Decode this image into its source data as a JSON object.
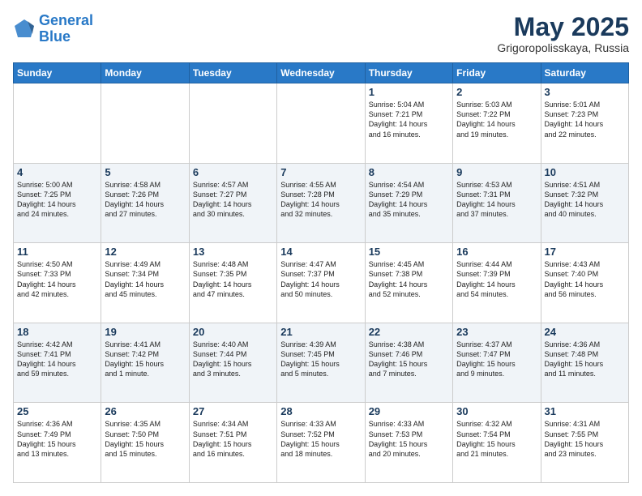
{
  "header": {
    "logo_line1": "General",
    "logo_line2": "Blue",
    "month": "May 2025",
    "location": "Grigoropolisskaya, Russia"
  },
  "weekdays": [
    "Sunday",
    "Monday",
    "Tuesday",
    "Wednesday",
    "Thursday",
    "Friday",
    "Saturday"
  ],
  "weeks": [
    [
      {
        "day": "",
        "text": ""
      },
      {
        "day": "",
        "text": ""
      },
      {
        "day": "",
        "text": ""
      },
      {
        "day": "",
        "text": ""
      },
      {
        "day": "1",
        "text": "Sunrise: 5:04 AM\nSunset: 7:21 PM\nDaylight: 14 hours\nand 16 minutes."
      },
      {
        "day": "2",
        "text": "Sunrise: 5:03 AM\nSunset: 7:22 PM\nDaylight: 14 hours\nand 19 minutes."
      },
      {
        "day": "3",
        "text": "Sunrise: 5:01 AM\nSunset: 7:23 PM\nDaylight: 14 hours\nand 22 minutes."
      }
    ],
    [
      {
        "day": "4",
        "text": "Sunrise: 5:00 AM\nSunset: 7:25 PM\nDaylight: 14 hours\nand 24 minutes."
      },
      {
        "day": "5",
        "text": "Sunrise: 4:58 AM\nSunset: 7:26 PM\nDaylight: 14 hours\nand 27 minutes."
      },
      {
        "day": "6",
        "text": "Sunrise: 4:57 AM\nSunset: 7:27 PM\nDaylight: 14 hours\nand 30 minutes."
      },
      {
        "day": "7",
        "text": "Sunrise: 4:55 AM\nSunset: 7:28 PM\nDaylight: 14 hours\nand 32 minutes."
      },
      {
        "day": "8",
        "text": "Sunrise: 4:54 AM\nSunset: 7:29 PM\nDaylight: 14 hours\nand 35 minutes."
      },
      {
        "day": "9",
        "text": "Sunrise: 4:53 AM\nSunset: 7:31 PM\nDaylight: 14 hours\nand 37 minutes."
      },
      {
        "day": "10",
        "text": "Sunrise: 4:51 AM\nSunset: 7:32 PM\nDaylight: 14 hours\nand 40 minutes."
      }
    ],
    [
      {
        "day": "11",
        "text": "Sunrise: 4:50 AM\nSunset: 7:33 PM\nDaylight: 14 hours\nand 42 minutes."
      },
      {
        "day": "12",
        "text": "Sunrise: 4:49 AM\nSunset: 7:34 PM\nDaylight: 14 hours\nand 45 minutes."
      },
      {
        "day": "13",
        "text": "Sunrise: 4:48 AM\nSunset: 7:35 PM\nDaylight: 14 hours\nand 47 minutes."
      },
      {
        "day": "14",
        "text": "Sunrise: 4:47 AM\nSunset: 7:37 PM\nDaylight: 14 hours\nand 50 minutes."
      },
      {
        "day": "15",
        "text": "Sunrise: 4:45 AM\nSunset: 7:38 PM\nDaylight: 14 hours\nand 52 minutes."
      },
      {
        "day": "16",
        "text": "Sunrise: 4:44 AM\nSunset: 7:39 PM\nDaylight: 14 hours\nand 54 minutes."
      },
      {
        "day": "17",
        "text": "Sunrise: 4:43 AM\nSunset: 7:40 PM\nDaylight: 14 hours\nand 56 minutes."
      }
    ],
    [
      {
        "day": "18",
        "text": "Sunrise: 4:42 AM\nSunset: 7:41 PM\nDaylight: 14 hours\nand 59 minutes."
      },
      {
        "day": "19",
        "text": "Sunrise: 4:41 AM\nSunset: 7:42 PM\nDaylight: 15 hours\nand 1 minute."
      },
      {
        "day": "20",
        "text": "Sunrise: 4:40 AM\nSunset: 7:44 PM\nDaylight: 15 hours\nand 3 minutes."
      },
      {
        "day": "21",
        "text": "Sunrise: 4:39 AM\nSunset: 7:45 PM\nDaylight: 15 hours\nand 5 minutes."
      },
      {
        "day": "22",
        "text": "Sunrise: 4:38 AM\nSunset: 7:46 PM\nDaylight: 15 hours\nand 7 minutes."
      },
      {
        "day": "23",
        "text": "Sunrise: 4:37 AM\nSunset: 7:47 PM\nDaylight: 15 hours\nand 9 minutes."
      },
      {
        "day": "24",
        "text": "Sunrise: 4:36 AM\nSunset: 7:48 PM\nDaylight: 15 hours\nand 11 minutes."
      }
    ],
    [
      {
        "day": "25",
        "text": "Sunrise: 4:36 AM\nSunset: 7:49 PM\nDaylight: 15 hours\nand 13 minutes."
      },
      {
        "day": "26",
        "text": "Sunrise: 4:35 AM\nSunset: 7:50 PM\nDaylight: 15 hours\nand 15 minutes."
      },
      {
        "day": "27",
        "text": "Sunrise: 4:34 AM\nSunset: 7:51 PM\nDaylight: 15 hours\nand 16 minutes."
      },
      {
        "day": "28",
        "text": "Sunrise: 4:33 AM\nSunset: 7:52 PM\nDaylight: 15 hours\nand 18 minutes."
      },
      {
        "day": "29",
        "text": "Sunrise: 4:33 AM\nSunset: 7:53 PM\nDaylight: 15 hours\nand 20 minutes."
      },
      {
        "day": "30",
        "text": "Sunrise: 4:32 AM\nSunset: 7:54 PM\nDaylight: 15 hours\nand 21 minutes."
      },
      {
        "day": "31",
        "text": "Sunrise: 4:31 AM\nSunset: 7:55 PM\nDaylight: 15 hours\nand 23 minutes."
      }
    ]
  ]
}
